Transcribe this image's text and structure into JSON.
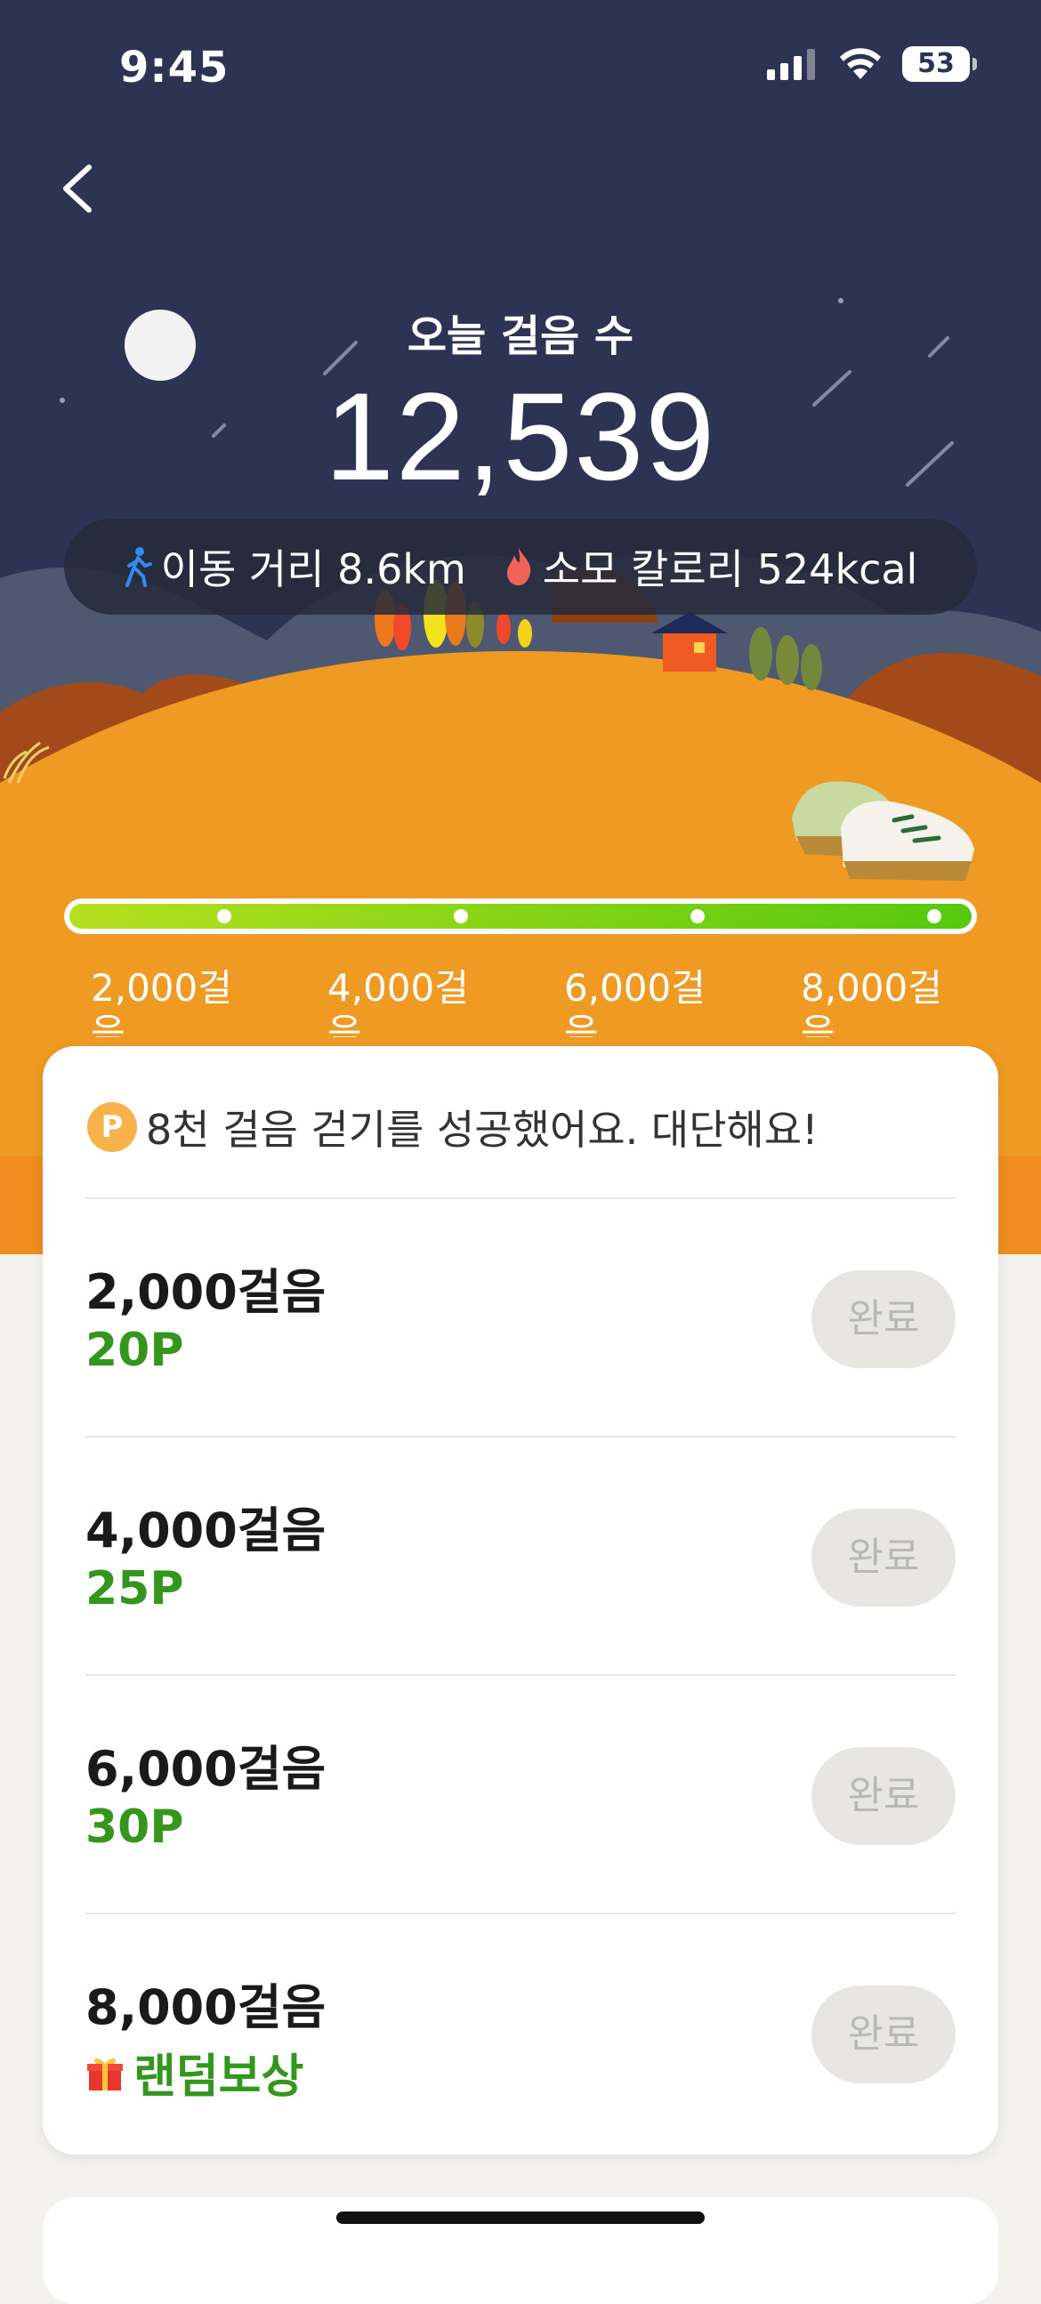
{
  "status_bar": {
    "time": "9:45",
    "battery": "53"
  },
  "header": {
    "title": "오늘 걸음 수",
    "step_count": "12,539"
  },
  "stats": {
    "distance": "이동 거리 8.6km",
    "calories": "소모 칼로리 524kcal"
  },
  "progress": {
    "value_fraction": 1.0,
    "milestones": [
      "2,000걸음",
      "4,000걸음",
      "6,000걸음",
      "8,000걸음"
    ]
  },
  "card": {
    "message_badge": "P",
    "message": "8천 걸음 걷기를 성공했어요. 대단해요!",
    "rows": [
      {
        "steps": "2,000걸음",
        "reward": "20P",
        "button": "완료"
      },
      {
        "steps": "4,000걸음",
        "reward": "25P",
        "button": "완료"
      },
      {
        "steps": "6,000걸음",
        "reward": "30P",
        "button": "완료"
      },
      {
        "steps": "8,000걸음",
        "reward": "랜덤보상",
        "reward_icon": "gift-icon",
        "button": "완료"
      }
    ]
  },
  "colors": {
    "night_sky": "#2d3352",
    "hill": "#ee9a23",
    "accent_green": "#34961c",
    "progress_start": "#b5e01e",
    "progress_end": "#55c90d"
  }
}
